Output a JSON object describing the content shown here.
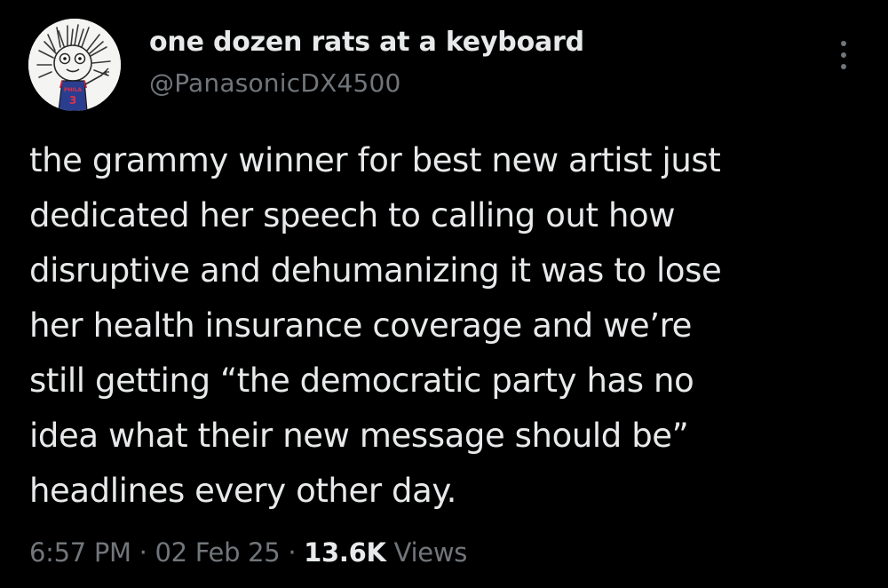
{
  "author": {
    "display_name": "one dozen rats at a keyboard",
    "handle": "@PanasonicDX4500",
    "avatar_icon": "hairy-cartoon-figure-avatar",
    "avatar_jersey_text": "PHILA",
    "avatar_jersey_number": "3"
  },
  "menu": {
    "icon": "more-options-icon"
  },
  "tweet": {
    "lines": [
      "the grammy winner for best new artist just",
      "dedicated her speech to calling out how",
      "disruptive and dehumanizing it was to lose",
      "her health insurance coverage and we’re",
      "still getting “the democratic party has no",
      "idea what their new message should be”",
      "headlines every other day."
    ]
  },
  "meta": {
    "time": "6:57 PM",
    "separator": "·",
    "date": "02 Feb 25",
    "views_count": "13.6K",
    "views_label": "Views"
  },
  "colors": {
    "background": "#000000",
    "primary_text": "#e7e9ea",
    "secondary_text": "#71767b"
  }
}
